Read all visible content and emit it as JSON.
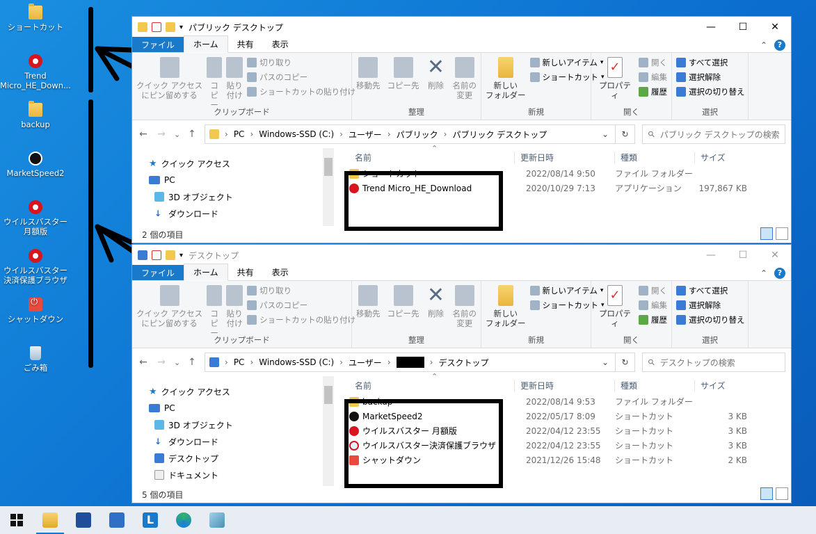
{
  "desktop": {
    "icons": [
      {
        "label": "ショートカット",
        "icon": "folder-icon"
      },
      {
        "label": "Trend Micro_HE_Down...",
        "icon": "trend-micro-icon"
      },
      {
        "label": "backup",
        "icon": "folder-icon"
      },
      {
        "label": "MarketSpeed2",
        "icon": "marketspeed-icon"
      },
      {
        "label": "ウイルスバスター 月額版",
        "icon": "virusbuster-icon"
      },
      {
        "label": "ウイルスバスター決済保護ブラウザ",
        "icon": "secure-browser-icon"
      },
      {
        "label": "シャットダウン",
        "icon": "shutdown-icon"
      },
      {
        "label": "ごみ箱",
        "icon": "recycle-bin-icon"
      }
    ]
  },
  "ribbon": {
    "tabs": {
      "file": "ファイル",
      "home": "ホーム",
      "share": "共有",
      "view": "表示"
    },
    "clipboard": {
      "pin": "クイック アクセス\nにピン留めする",
      "copy": "コピー",
      "paste": "貼り付け",
      "cut": "切り取り",
      "copy_path": "パスのコピー",
      "paste_shortcut": "ショートカットの貼り付け",
      "label": "クリップボード"
    },
    "organize": {
      "move": "移動先",
      "copy_to": "コピー先",
      "delete": "削除",
      "rename": "名前の\n変更",
      "label": "整理"
    },
    "new": {
      "new_folder": "新しい\nフォルダー",
      "new_item": "新しいアイテム",
      "shortcut": "ショートカット",
      "label": "新規"
    },
    "open": {
      "properties": "プロパティ",
      "open": "開く",
      "edit": "編集",
      "history": "履歴",
      "label": "開く"
    },
    "select": {
      "select_all": "すべて選択",
      "select_none": "選択解除",
      "invert": "選択の切り替え",
      "label": "選択"
    }
  },
  "columns": {
    "name": "名前",
    "date": "更新日時",
    "type": "種類",
    "size": "サイズ"
  },
  "nav": {
    "quick_access": "クイック アクセス",
    "pc": "PC",
    "objects3d": "3D オブジェクト",
    "downloads": "ダウンロード",
    "desktop": "デスクトップ",
    "documents": "ドキュメント"
  },
  "window1": {
    "title": "パブリック デスクトップ",
    "path": [
      "PC",
      "Windows-SSD (C:)",
      "ユーザー",
      "パブリック",
      "パブリック デスクトップ"
    ],
    "search_placeholder": "パブリック デスクトップの検索",
    "status": "2 個の項目",
    "files": [
      {
        "name": "ショートカット",
        "date": "2022/08/14 9:50",
        "type": "ファイル フォルダー",
        "size": "",
        "icon": "folder"
      },
      {
        "name": "Trend Micro_HE_Download",
        "date": "2020/10/29 7:13",
        "type": "アプリケーション",
        "size": "197,867 KB",
        "icon": "red"
      }
    ]
  },
  "window2": {
    "title": "デスクトップ",
    "path_pre": [
      "PC",
      "Windows-SSD (C:)",
      "ユーザー"
    ],
    "path_post": "デスクトップ",
    "search_placeholder": "デスクトップの検索",
    "status": "5 個の項目",
    "files": [
      {
        "name": "backup",
        "date": "2022/08/14 9:53",
        "type": "ファイル フォルダー",
        "size": "",
        "icon": "folder"
      },
      {
        "name": "MarketSpeed2",
        "date": "2022/05/17 8:09",
        "type": "ショートカット",
        "size": "3 KB",
        "icon": "ms"
      },
      {
        "name": "ウイルスバスター 月額版",
        "date": "2022/04/12 23:55",
        "type": "ショートカット",
        "size": "3 KB",
        "icon": "red"
      },
      {
        "name": "ウイルスバスター決済保護ブラウザ",
        "date": "2022/04/12 23:55",
        "type": "ショートカット",
        "size": "3 KB",
        "icon": "redsq"
      },
      {
        "name": "シャットダウン",
        "date": "2021/12/26 15:48",
        "type": "ショートカット",
        "size": "2 KB",
        "icon": "pwr"
      }
    ]
  },
  "taskbar": {
    "items": [
      "start-icon",
      "file-explorer-icon",
      "store-icon",
      "mail-icon",
      "l-app-icon",
      "edge-icon",
      "notepad-icon"
    ]
  },
  "colors": {
    "accent": "#1979ca",
    "desktop": "#0b6fd0",
    "annotation": "#000000"
  }
}
